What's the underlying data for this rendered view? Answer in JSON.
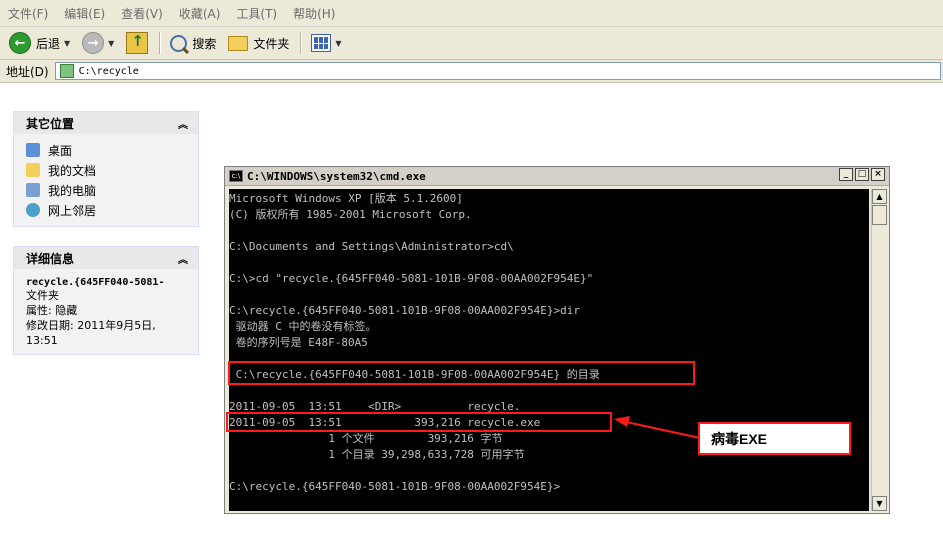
{
  "menu": [
    "文件(F)",
    "编辑(E)",
    "查看(V)",
    "收藏(A)",
    "工具(T)",
    "帮助(H)"
  ],
  "toolbar": {
    "back_label": "后退",
    "search_label": "搜索",
    "folders_label": "文件夹"
  },
  "address": {
    "label": "地址(D)",
    "value": "C:\\recycle"
  },
  "other_places": {
    "title": "其它位置",
    "items": [
      "桌面",
      "我的文档",
      "我的电脑",
      "网上邻居"
    ]
  },
  "details": {
    "title": "详细信息",
    "name": "recycle.{645FF040-5081-",
    "type": "文件夹",
    "attr": "属性: 隐藏",
    "modified": "修改日期: 2011年9月5日,",
    "time": "13:51"
  },
  "cmd": {
    "title": "C:\\WINDOWS\\system32\\cmd.exe",
    "lines": [
      "Microsoft Windows XP [版本 5.1.2600]",
      "(C) 版权所有 1985-2001 Microsoft Corp.",
      "",
      "C:\\Documents and Settings\\Administrator>cd\\",
      "",
      "C:\\>cd \"recycle.{645FF040-5081-101B-9F08-00AA002F954E}\"",
      "",
      "C:\\recycle.{645FF040-5081-101B-9F08-00AA002F954E}>dir",
      " 驱动器 C 中的卷没有标签。",
      " 卷的序列号是 E48F-80A5",
      "",
      " C:\\recycle.{645FF040-5081-101B-9F08-00AA002F954E} 的目录",
      "",
      "2011-09-05  13:51    <DIR>          recycle.",
      "2011-09-05  13:51           393,216 recycle.exe",
      "               1 个文件        393,216 字节",
      "               1 个目录 39,298,633,728 可用字节",
      "",
      "C:\\recycle.{645FF040-5081-101B-9F08-00AA002F954E}>"
    ]
  },
  "annotation": {
    "label": "病毒EXE",
    "color": "#ff1a1a"
  }
}
